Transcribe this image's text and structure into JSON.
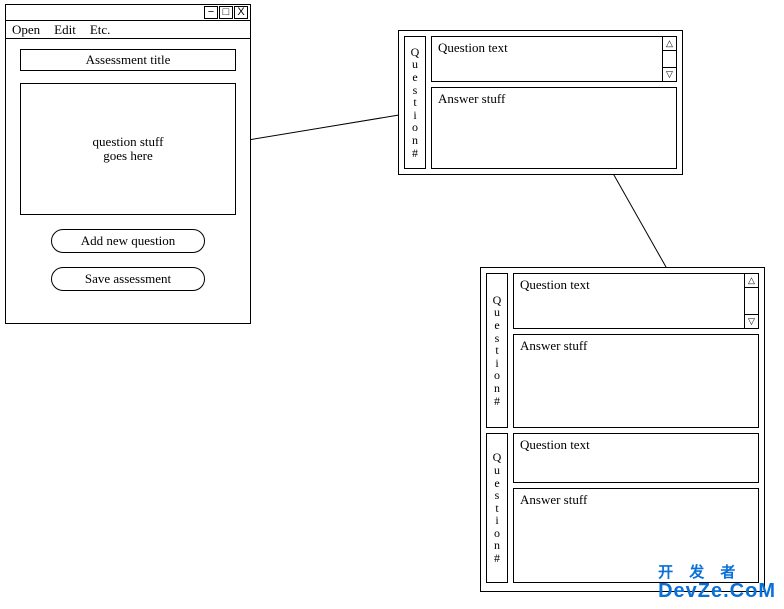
{
  "editor": {
    "menu": {
      "open": "Open",
      "edit": "Edit",
      "etc": "Etc."
    },
    "title_field": "Assessment title",
    "content_placeholder": "question stuff\ngoes here",
    "add_btn": "Add new question",
    "save_btn": "Save assessment"
  },
  "panel_a": {
    "q1": {
      "label": "Q\nu\ne\ns\nt\ni\no\nn\n#",
      "qtext": "Question text",
      "ans": "Answer stuff"
    }
  },
  "panel_b": {
    "q1": {
      "label": "Q\nu\ne\ns\nt\ni\no\nn\n#",
      "qtext": "Question text",
      "ans": "Answer stuff"
    },
    "q2": {
      "label": "Q\nu\ne\ns\nt\ni\no\nn\n#",
      "qtext": "Question text",
      "ans": "Answer stuff"
    }
  },
  "watermark": {
    "cn": "开 发 者",
    "en": "DevZe.CoM"
  }
}
